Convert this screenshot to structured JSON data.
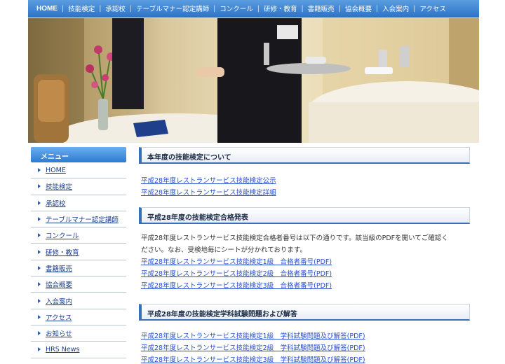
{
  "topnav": {
    "items": [
      "HOME",
      "技能検定",
      "承認校",
      "テーブルマナー認定講師",
      "コンクール",
      "研修・教育",
      "書籍販売",
      "協会概要",
      "入会案内",
      "アクセス"
    ]
  },
  "hero": {
    "description_icon": "restaurant-service-photo"
  },
  "sidebar": {
    "header": "メニュー",
    "items": [
      "HOME",
      "技能検定",
      "承認校",
      "テーブルマナー認定講師",
      "コンクール",
      "研修・教育",
      "書籍販売",
      "協会概要",
      "入会案内",
      "アクセス",
      "お知らせ",
      "HRS News"
    ]
  },
  "main": {
    "section1": {
      "title": "本年度の技能検定について",
      "links": [
        "平成28年度レストランサービス技能検定公示",
        "平成28年度レストランサービス技能検定詳細"
      ]
    },
    "section2": {
      "title": "平成28年度の技能検定合格発表",
      "text_line1": "平成28年度レストランサービス技能検定合格者番号は以下の通りです。該当級のPDFを開いてご確認く",
      "text_line2": "ださい。なお、受検地毎にシートが分かれております。",
      "links": [
        "平成28年度レストランサービス技能検定1級　合格者番号(PDF)",
        "平成28年度レストランサービス技能検定2級　合格者番号(PDF)",
        "平成28年度レストランサービス技能検定3級　合格者番号(PDF)"
      ]
    },
    "section3": {
      "title": "平成28年度の技能検定学科試験問題および解答",
      "links": [
        "平成28年度レストランサービス技能検定1級　学科試験問題及び解答(PDF)",
        "平成28年度レストランサービス技能検定2級　学科試験問題及び解答(PDF)",
        "平成28年度レストランサービス技能検定3級　学科試験問題及び解答(PDF)"
      ]
    }
  },
  "colors": {
    "nav_blue": "#2f74c8",
    "link_blue": "#2a4fd0",
    "section_accent": "#3a6fb8"
  }
}
